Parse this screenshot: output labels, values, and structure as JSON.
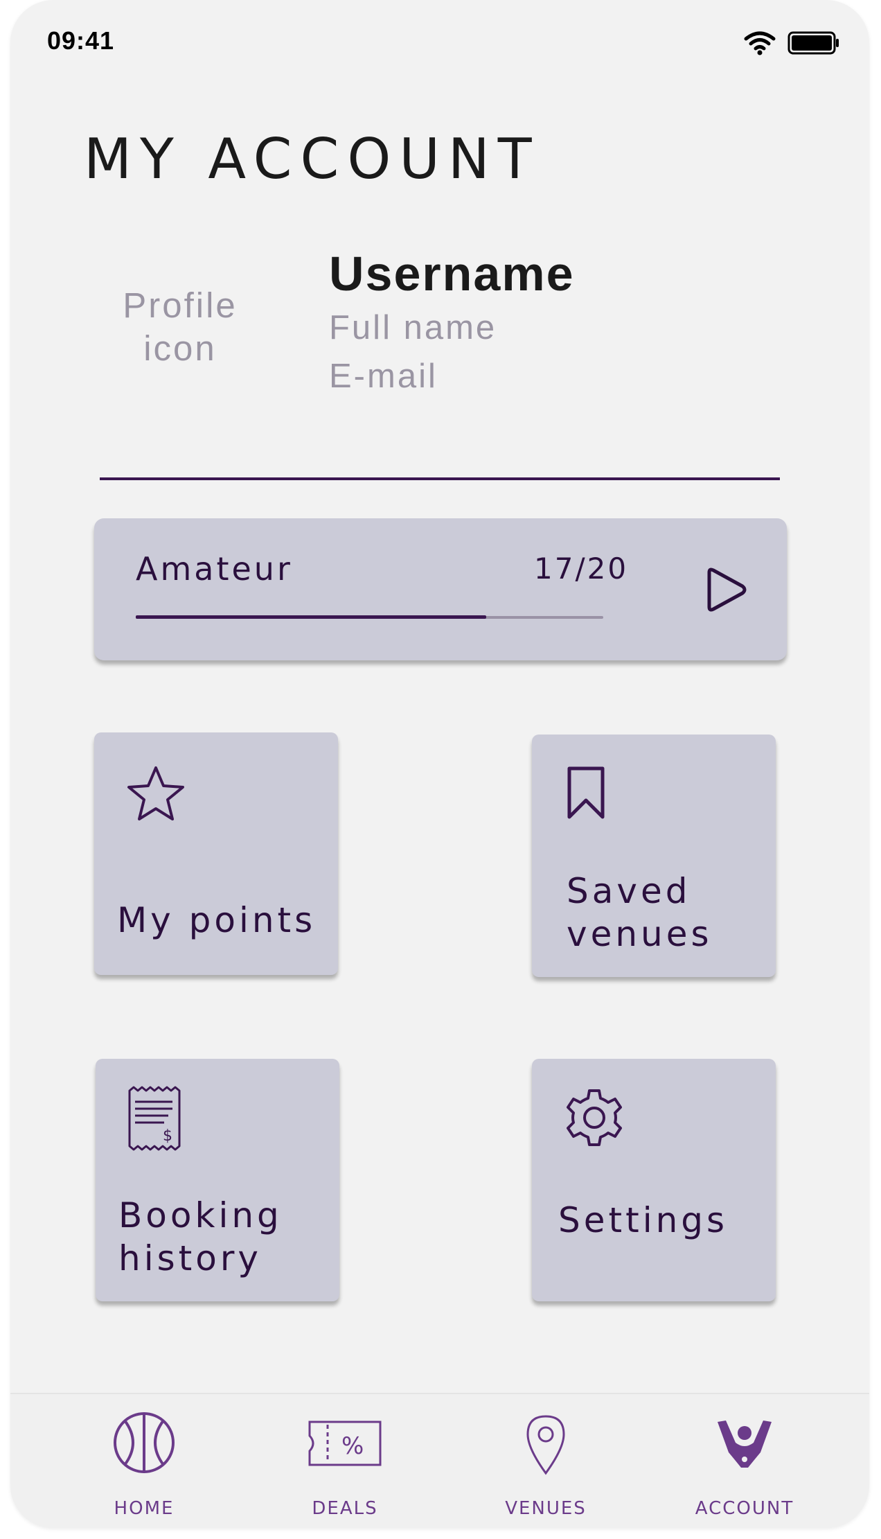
{
  "status_bar": {
    "time": "09:41",
    "icons": [
      "wifi-icon",
      "battery-icon"
    ]
  },
  "header": {
    "title": "MY ACCOUNT"
  },
  "profile": {
    "avatar_placeholder_line1": "Profile",
    "avatar_placeholder_line2": "icon",
    "username": "Username",
    "full_name": "Full name",
    "email": "E-mail"
  },
  "level": {
    "name": "Amateur",
    "progress_text": "17/20",
    "progress_fraction": 0.75,
    "icon": "play-icon"
  },
  "tiles": [
    {
      "label": "My points",
      "icon": "star-icon"
    },
    {
      "label_line1": "Saved",
      "label_line2": "venues",
      "icon": "bookmark-icon"
    },
    {
      "label_line1": "Booking",
      "label_line2": "history",
      "icon": "receipt-icon"
    },
    {
      "label": "Settings",
      "icon": "gear-icon"
    }
  ],
  "tab_bar": {
    "tabs": [
      {
        "label": "HOME",
        "icon": "basketball-icon",
        "active": false
      },
      {
        "label": "DEALS",
        "icon": "ticket-percent-icon",
        "active": false
      },
      {
        "label": "VENUES",
        "icon": "location-pin-icon",
        "active": false
      },
      {
        "label": "ACCOUNT",
        "icon": "person-cheer-icon",
        "active": true
      }
    ]
  },
  "colors": {
    "background": "#f2f2f2",
    "card": "#cbcbd8",
    "primary_dark": "#2a0f3d",
    "accent_purple": "#6b3b8a",
    "placeholder_gray": "#9a95a3"
  }
}
